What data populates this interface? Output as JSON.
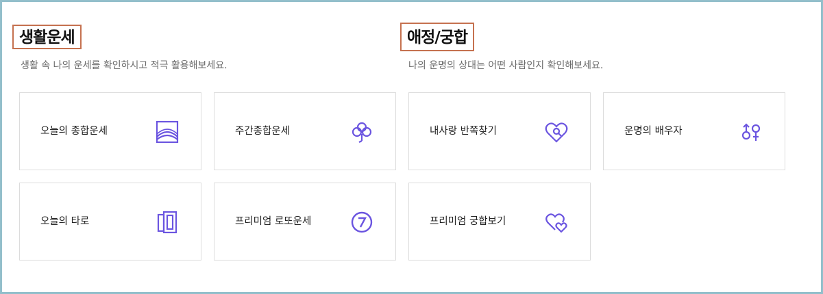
{
  "accent_color": "#6b55e0",
  "life": {
    "title": "생활운세",
    "subtitle": "생활 속 나의 운세를 확인하시고 적극 활용해보세요.",
    "cards": [
      {
        "label": "오늘의 종합운세",
        "icon": "landscape-frame-icon"
      },
      {
        "label": "주간종합운세",
        "icon": "clover-icon"
      },
      {
        "label": "오늘의 타로",
        "icon": "tarot-cards-icon"
      },
      {
        "label": "프리미엄 로또운세",
        "icon": "lotto-seven-icon"
      }
    ]
  },
  "love": {
    "title": "애정/궁합",
    "subtitle": "나의 운명의 상대는 어떤 사람인지 확인해보세요.",
    "cards": [
      {
        "label": "내사랑 반쪽찾기",
        "icon": "heart-search-icon"
      },
      {
        "label": "운명의 배우자",
        "icon": "gender-symbols-icon"
      },
      {
        "label": "프리미엄 궁합보기",
        "icon": "double-heart-icon"
      }
    ]
  }
}
